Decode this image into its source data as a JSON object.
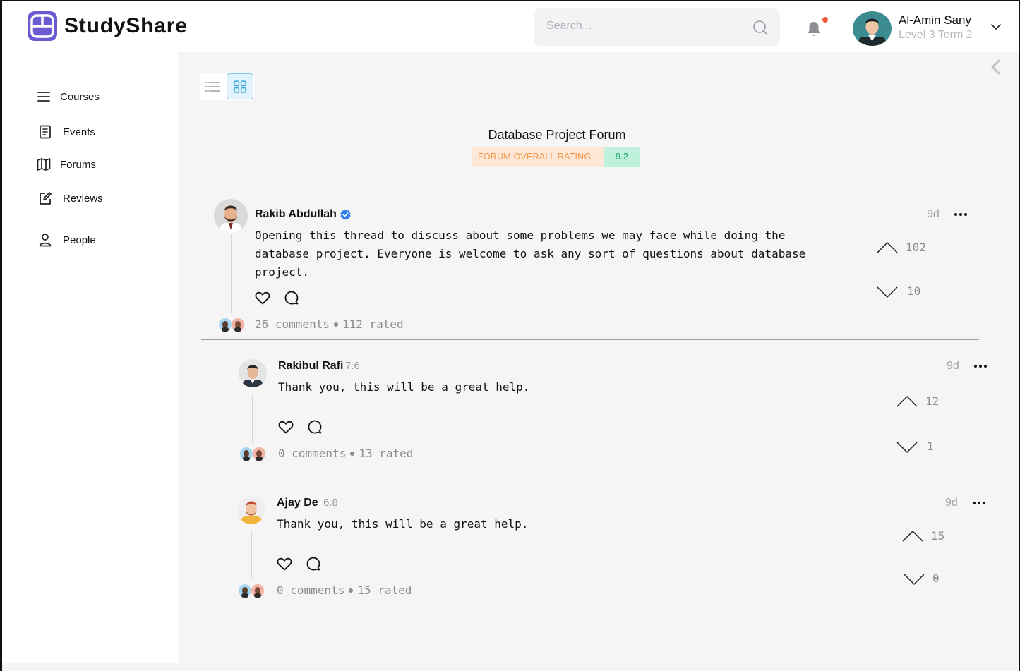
{
  "app": {
    "name": "StudyShare"
  },
  "search": {
    "placeholder": "Search..."
  },
  "user": {
    "name": "Al-Amin Sany",
    "level": "Level 3 Term 2"
  },
  "sidebar": {
    "items": [
      {
        "label": "Courses",
        "icon": "menu-icon"
      },
      {
        "label": "Events",
        "icon": "document-icon"
      },
      {
        "label": "Forums",
        "icon": "map-icon"
      },
      {
        "label": "Reviews",
        "icon": "edit-icon"
      },
      {
        "label": "People",
        "icon": "person-icon"
      }
    ]
  },
  "forum": {
    "title": "Database Project Forum",
    "rating_label": "FORUM OVERALL RATING :",
    "rating_value": "9.2"
  },
  "posts": [
    {
      "author": "Rakib Abdullah",
      "verified": true,
      "text": "Opening this thread to discuss about some problems we may face while doing the\ndatabase project. Everyone is welcome to ask any sort of questions about database\nproject.",
      "time": "9d",
      "upvotes": "102",
      "downvotes": "10",
      "comments": "26 comments",
      "rated": "112 rated"
    },
    {
      "author": "Rakibul Rafi",
      "score": "7.6",
      "text": "Thank you, this will be a great help.",
      "time": "9d",
      "upvotes": "12",
      "downvotes": "1",
      "comments": "0 comments",
      "rated": "13 rated"
    },
    {
      "author": "Ajay De",
      "score": "6.8",
      "text": "Thank you, this will be a great help.",
      "time": "9d",
      "upvotes": "15",
      "downvotes": "0",
      "comments": "0 comments",
      "rated": "15 rated"
    }
  ],
  "colors": {
    "brand": "#6b5bd2",
    "rating_bg": "#fde8d7",
    "rating_text": "#f1974a",
    "score_bg": "#bff1dc",
    "score_text": "#1aa86b",
    "notification_dot": "#f25a3c",
    "verified": "#2f80ed"
  }
}
